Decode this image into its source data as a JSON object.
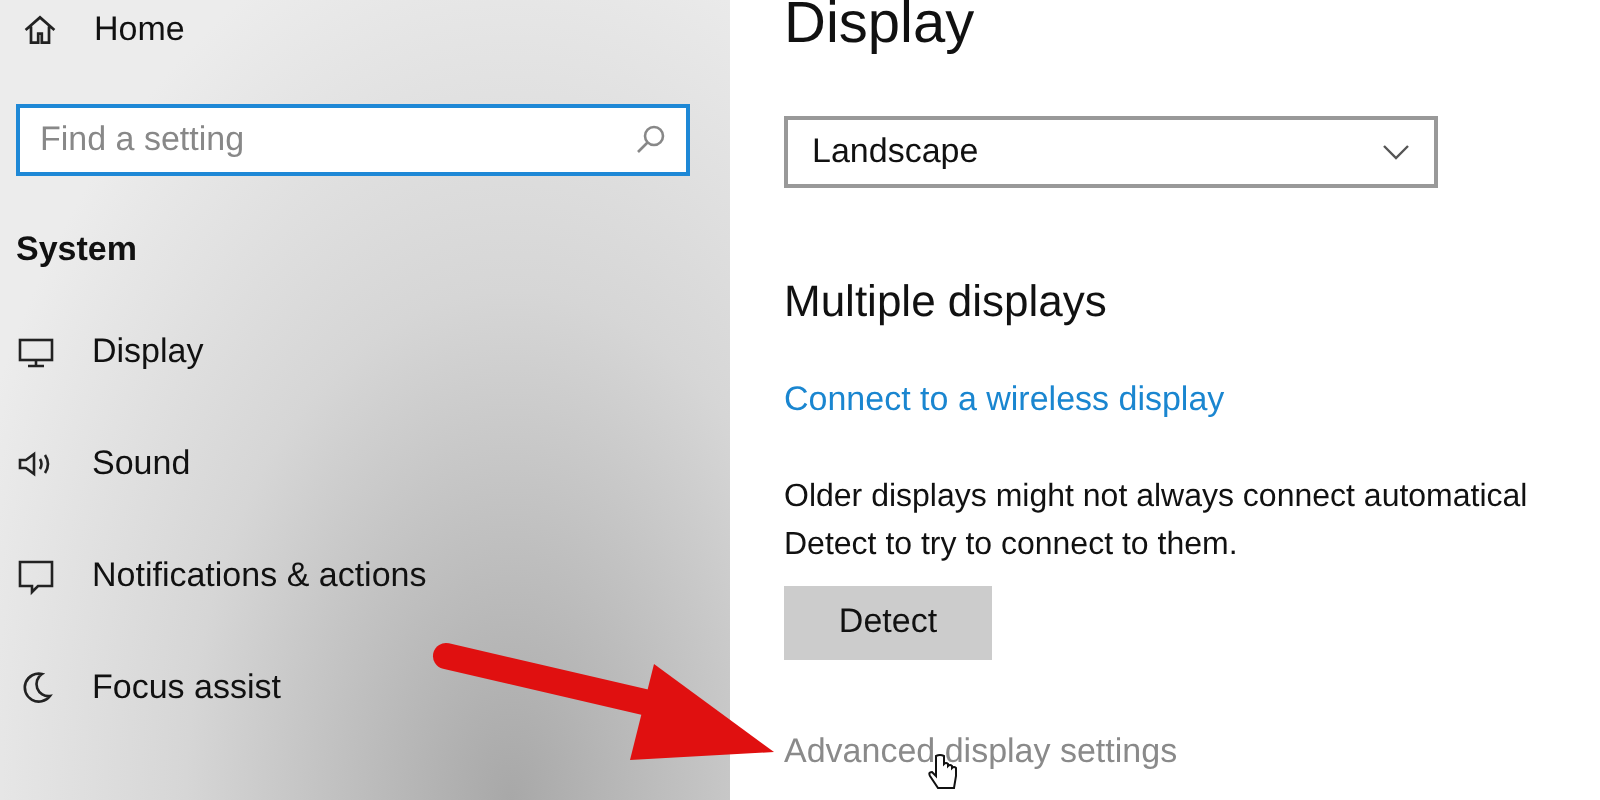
{
  "sidebar": {
    "home": "Home",
    "search": {
      "placeholder": "Find a setting"
    },
    "section": "System",
    "items": [
      {
        "kind": "display",
        "label": "Display"
      },
      {
        "kind": "sound",
        "label": "Sound"
      },
      {
        "kind": "notifications",
        "label": "Notifications & actions"
      },
      {
        "kind": "focus",
        "label": "Focus assist"
      }
    ]
  },
  "main": {
    "title": "Display",
    "orientation": {
      "value": "Landscape"
    },
    "heading": "Multiple displays",
    "link": "Connect to a wireless display",
    "text_lines": [
      "Older displays might not always connect automatical",
      "Detect to try to connect to them."
    ],
    "button": "Detect",
    "advanced_link": "Advanced display settings"
  }
}
